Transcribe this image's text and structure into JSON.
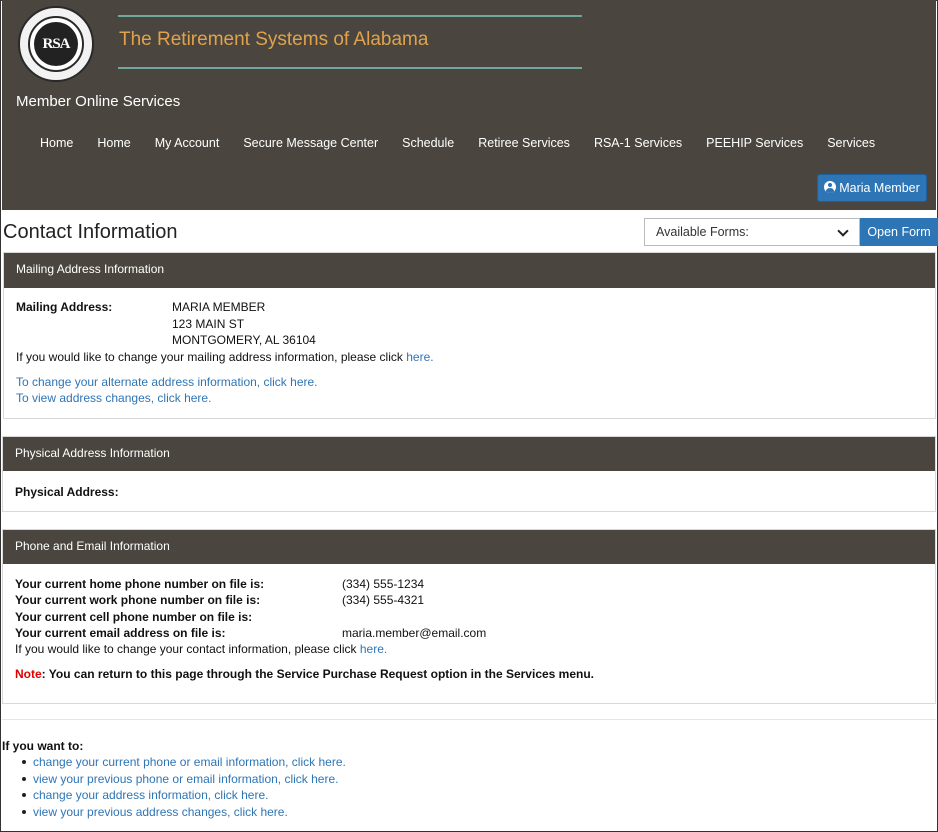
{
  "header": {
    "logo_text": "RSA",
    "logo_ring_text": "THE RETIREMENT SYSTEMS OF ALABAMA",
    "brand": "The Retirement Systems of Alabama",
    "app_title": "Member Online Services",
    "nav": [
      "Home",
      "Home",
      "My Account",
      "Secure Message Center",
      "Schedule",
      "Retiree Services",
      "RSA-1 Services",
      "PEEHIP Services",
      "Services"
    ],
    "user_button": "Maria Member",
    "user_icon": "user-circle-icon"
  },
  "page": {
    "title": "Contact Information",
    "forms_select": "Available Forms:",
    "open_form_button": "Open Form"
  },
  "mailing": {
    "heading": "Mailing Address Information",
    "label": "Mailing Address:",
    "address_lines": [
      "MARIA MEMBER",
      "123 MAIN ST",
      "MONTGOMERY, AL 36104"
    ],
    "change_text": "If you would like to change your mailing address information, please click",
    "change_link": "here.",
    "alt_link": "To change your alternate address information, click here.",
    "view_link": "To view address changes, click here."
  },
  "physical": {
    "heading": "Physical Address Information",
    "label": "Physical Address:"
  },
  "phone": {
    "heading": "Phone and Email Information",
    "rows": [
      {
        "label": "Your current home phone number on file is:",
        "value": "(334) 555-1234"
      },
      {
        "label": "Your current work phone number on file is:",
        "value": "(334) 555-4321"
      },
      {
        "label": "Your current cell phone number on file is:",
        "value": ""
      },
      {
        "label": "Your current email address on file is:",
        "value": "maria.member@email.com"
      }
    ],
    "change_text": "If you would like to change your contact information, please click",
    "change_link": "here.",
    "note_label": "Note",
    "note_text": ": You can return to this page through the Service Purchase Request option in the Services menu."
  },
  "footer": {
    "want": "If you want to:",
    "links": [
      "change your current phone or email information, click here.",
      "view your previous phone or email information, click here.",
      "change your address information, click here.",
      "view your previous address changes, click here."
    ]
  },
  "colors": {
    "header_bg": "#4a463f",
    "brand": "#e0a24c",
    "link": "#2e75b6",
    "note": "#e00000"
  }
}
